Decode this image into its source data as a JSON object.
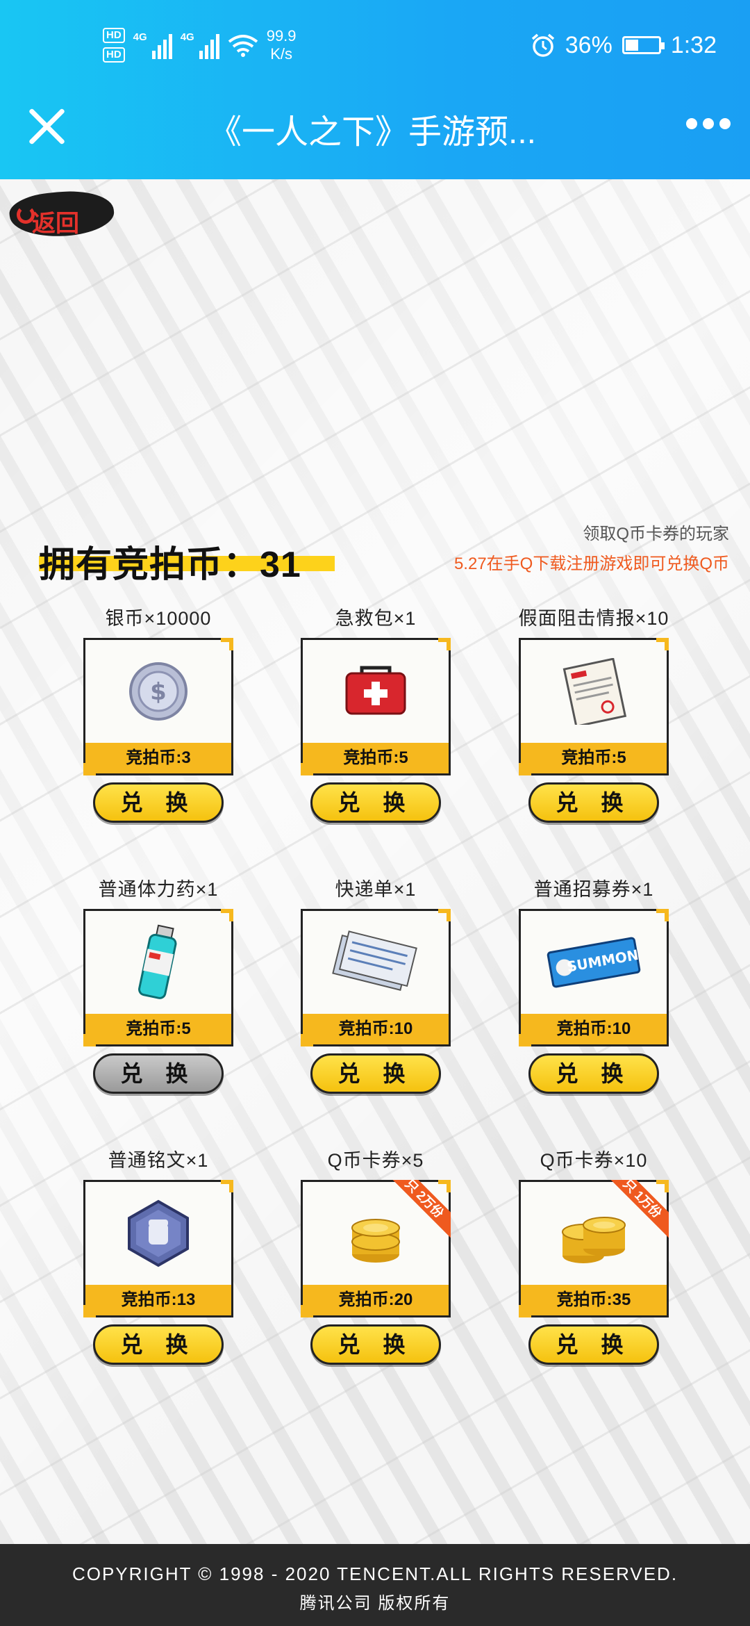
{
  "status_bar": {
    "hd1": "HD",
    "hd2": "HD",
    "net1": "4G",
    "net2": "4G",
    "speed_value": "99.9",
    "speed_unit": "K/s",
    "battery": "36%",
    "time": "1:32"
  },
  "titlebar": {
    "title": "《一人之下》手游预..."
  },
  "back_label": "返回",
  "coins": {
    "label": "拥有竞拍币：31"
  },
  "note": {
    "line1": "领取Q币卡券的玩家",
    "line2": "5.27在手Q下载注册游戏即可兑换Q币"
  },
  "redeem_label": "兑 换",
  "items": [
    {
      "name": "银币×10000",
      "price": "竞拍币:3",
      "icon": "silver-coin-icon"
    },
    {
      "name": "急救包×1",
      "price": "竞拍币:5",
      "icon": "first-aid-kit-icon"
    },
    {
      "name": "假面阻击情报×10",
      "price": "竞拍币:5",
      "icon": "document-icon"
    },
    {
      "name": "普通体力药×1",
      "price": "竞拍币:5",
      "icon": "potion-bottle-icon"
    },
    {
      "name": "快递单×1",
      "price": "竞拍币:10",
      "icon": "delivery-slip-icon"
    },
    {
      "name": "普通招募券×1",
      "price": "竞拍币:10",
      "icon": "summon-ticket-icon"
    },
    {
      "name": "普通铭文×1",
      "price": "竞拍币:13",
      "icon": "inscription-icon"
    },
    {
      "name": "Q币卡券×5",
      "price": "竞拍币:20",
      "icon": "gold-coins-icon",
      "ribbon": "只 2万份"
    },
    {
      "name": "Q币卡券×10",
      "price": "竞拍币:35",
      "icon": "gold-coins-icon",
      "ribbon": "只 1万份"
    }
  ],
  "summon_text": "SUMMON",
  "footer": {
    "copyright": "COPYRIGHT © 1998 - 2020 TENCENT.ALL RIGHTS RESERVED.",
    "company": "腾讯公司 版权所有"
  },
  "colors": {
    "titlebar": "#1aa7f5",
    "accent_yellow": "#f6b81e",
    "note_orange": "#ef5a1f",
    "footer_bg": "#2a2a2a"
  }
}
